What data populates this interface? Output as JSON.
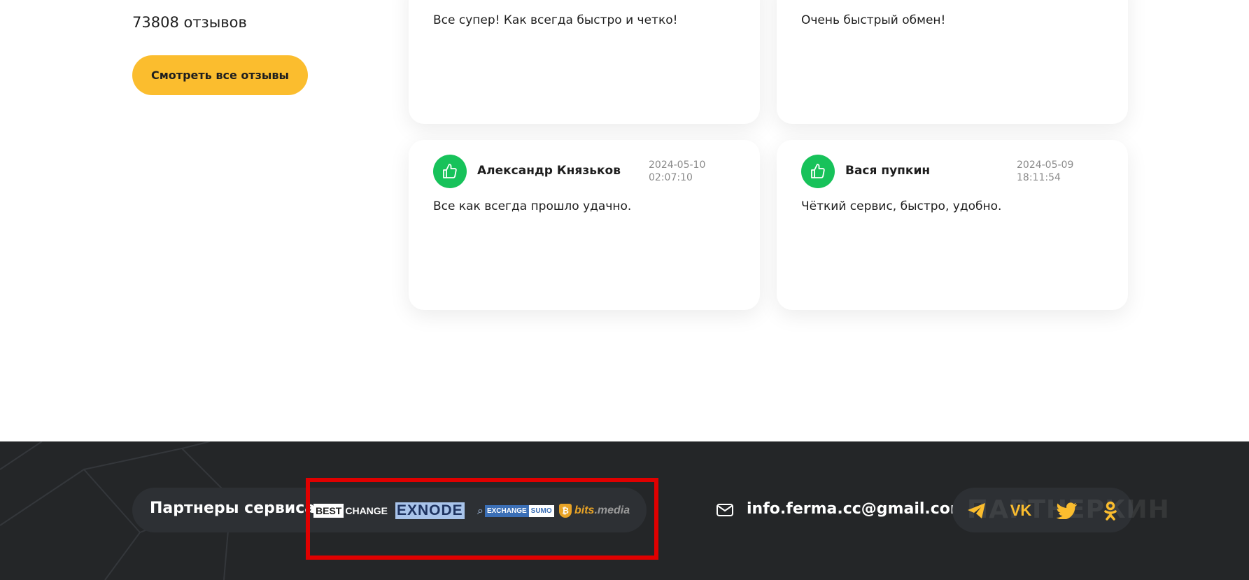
{
  "reviews_summary": {
    "count_text": "73808 отзывов",
    "all_reviews_label": "Смотреть все отзывы"
  },
  "reviews": [
    {
      "text": "Все супер! Как всегда быстро и четко!"
    },
    {
      "text": "Очень быстрый обмен!"
    },
    {
      "name": "Александр Князьков",
      "date_line1": "2024-05-10",
      "date_line2": "02:07:10",
      "text": "Все как всегда прошло удачно."
    },
    {
      "name": "Вася пупкин",
      "date_line1": "2024-05-09",
      "date_line2": "18:11:54",
      "text": "Чёткий сервис, быстро, удобно."
    }
  ],
  "footer": {
    "partners_label": "Партнеры сервиса:",
    "partners": [
      {
        "name": "BESTCHANGE",
        "part1": "BEST",
        "part2": "CHANGE",
        "icon": "bestchange-logo"
      },
      {
        "name": "EXNODE",
        "icon": "exnode-logo"
      },
      {
        "name": "EXCHANGESUMO",
        "part1": "EXCHANGE",
        "part2": "SUMO",
        "icon": "exchangesumo-logo"
      },
      {
        "name": "bits.media",
        "part1": "bits",
        "part2": ".media",
        "icon": "bitsmedia-logo"
      }
    ],
    "email": "info.ferma.cc@gmail.com",
    "social_icons": [
      "telegram-icon",
      "vk-icon",
      "twitter-icon",
      "odnoklassniki-icon"
    ],
    "watermark": "ПАРТНЕРКИН"
  },
  "colors": {
    "accent": "#fbbd2e",
    "like_green": "#17c25a",
    "footer_bg": "#242628",
    "highlight": "#e00000"
  }
}
